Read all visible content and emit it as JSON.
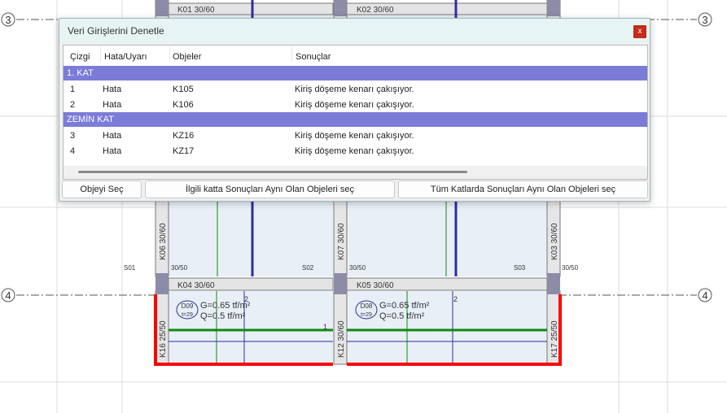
{
  "drawing": {
    "axes": [
      "3",
      "4"
    ],
    "beams": [
      "K01 30/60",
      "K02 30/60",
      "K04 30/60",
      "K05 30/60"
    ],
    "columns": [
      "K06 30/60",
      "K07 30/60",
      "K03 30/60",
      "K16 25/50",
      "K12 30/60",
      "K17 25/50"
    ],
    "column_sizes": [
      "30/50",
      "30/50",
      "30/50"
    ],
    "slabs": [
      "S01",
      "S02",
      "S03"
    ],
    "slab_labels": [
      {
        "id": "D09",
        "thickness": "t=29",
        "G": "G=0.65 tf/m²",
        "Q": "Q=0.5 tf/m²"
      },
      {
        "id": "D08",
        "thickness": "t=29",
        "G": "G=0.65 tf/m²",
        "Q": "Q=0.5 tf/m²"
      }
    ],
    "marks": [
      "2",
      "1",
      "2"
    ]
  },
  "dialog": {
    "title": "Veri Girişlerini Denetle",
    "close_label": "x",
    "columns": [
      "Çizgi",
      "Hata/Uyarı",
      "Objeler",
      "Sonuçlar"
    ],
    "groups": [
      {
        "name": "1. KAT",
        "rows": [
          {
            "line": "1",
            "type": "Hata",
            "object": "K105",
            "result": "Kiriş döşeme kenarı çakışıyor."
          },
          {
            "line": "2",
            "type": "Hata",
            "object": "K106",
            "result": "Kiriş döşeme kenarı çakışıyor."
          }
        ]
      },
      {
        "name": "ZEMİN KAT",
        "rows": [
          {
            "line": "3",
            "type": "Hata",
            "object": "KZ16",
            "result": "Kiriş döşeme kenarı çakışıyor."
          },
          {
            "line": "4",
            "type": "Hata",
            "object": "KZ17",
            "result": "Kiriş döşeme kenarı çakışıyor."
          }
        ]
      }
    ],
    "buttons": {
      "select": "Objeyi Seç",
      "same_floor": "İlgili katta Sonuçları Aynı Olan Objeleri seç",
      "all_floors": "Tüm Katlarda Sonuçları Aynı Olan Objeleri seç"
    }
  },
  "colors": {
    "group_row": "#7b7bd8",
    "error_line": "#ff0000",
    "beam_blue": "#2e2e9e",
    "green_line": "#0f8a0f"
  }
}
